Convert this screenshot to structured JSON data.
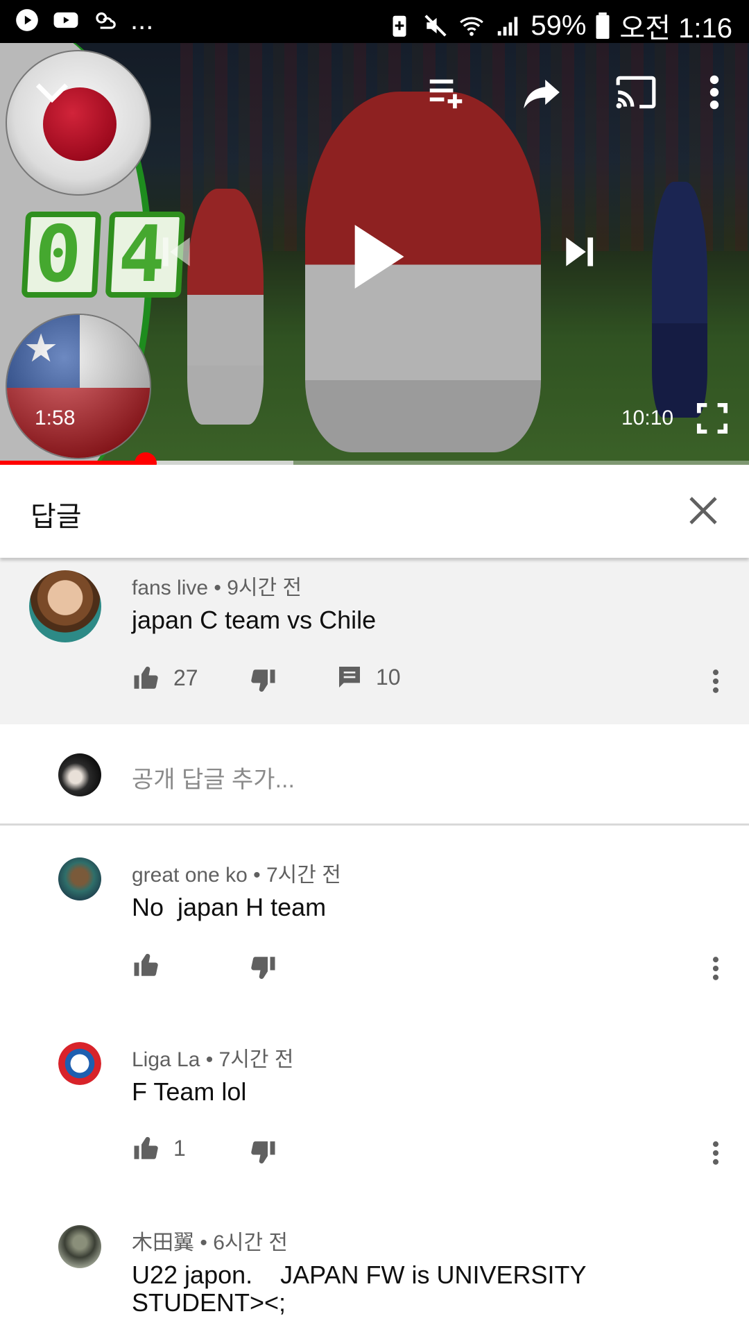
{
  "status_bar": {
    "left_icons": [
      "play-circle-icon",
      "youtube-icon",
      "cloud-sun-icon"
    ],
    "more": "...",
    "right_icons": [
      "battery-saver-icon",
      "mute-icon",
      "wifi-icon",
      "signal-icon"
    ],
    "battery": "59%",
    "time": "오전 1:16"
  },
  "player": {
    "score": [
      "0",
      "4"
    ],
    "current_time": "1:58",
    "duration": "10:10",
    "played_fraction": 0.194,
    "buffered_fraction": 0.392,
    "icons": {
      "collapse": "chevron-down-icon",
      "add_to_queue": "playlist-add-icon",
      "share": "share-icon",
      "cast": "cast-icon",
      "more": "more-vertical-icon",
      "previous": "skip-previous-icon",
      "play": "play-icon",
      "next": "skip-next-icon",
      "fullscreen": "fullscreen-icon"
    }
  },
  "replies_panel": {
    "title": "답글",
    "close_icon": "close-icon"
  },
  "parent_comment": {
    "author": "fans live",
    "time": "9시간 전",
    "text": "japan C team vs Chile",
    "likes": "27",
    "replies": "10"
  },
  "add_reply": {
    "placeholder": "공개 답글 추가..."
  },
  "replies": [
    {
      "author": "great one ko",
      "time": "7시간 전",
      "text": "No  japan H team",
      "likes": ""
    },
    {
      "author": "Liga La",
      "time": "7시간 전",
      "text": "F Team lol",
      "likes": "1"
    },
    {
      "author": "木田翼",
      "time": "6시간 전",
      "text": "U22 japon.    JAPAN FW is UNIVERSITY STUDENT><;",
      "likes": ""
    }
  ],
  "meta_separator": "•",
  "colors": {
    "accent": "#ff0000",
    "score_green": "#2f8f1e"
  }
}
